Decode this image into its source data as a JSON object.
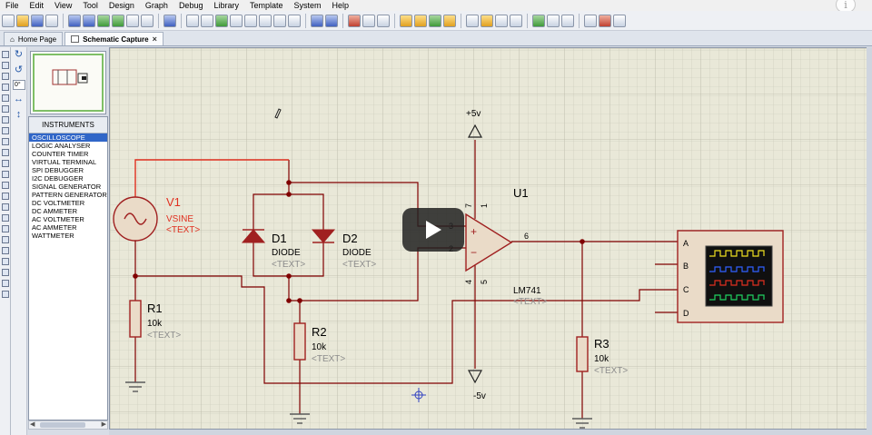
{
  "menu": [
    "File",
    "Edit",
    "View",
    "Tool",
    "Design",
    "Graph",
    "Debug",
    "Library",
    "Template",
    "System",
    "Help"
  ],
  "tabs": [
    {
      "label": "Home Page",
      "icon": "home-icon",
      "closable": false
    },
    {
      "label": "Schematic Capture",
      "icon": "schematic-icon",
      "closable": true
    }
  ],
  "left_panel": {
    "rotation_value": "0°",
    "devices_title": "INSTRUMENTS",
    "devices": [
      "OSCILLOSCOPE",
      "LOGIC ANALYSER",
      "COUNTER TIMER",
      "VIRTUAL TERMINAL",
      "SPI DEBUGGER",
      "I2C DEBUGGER",
      "SIGNAL GENERATOR",
      "PATTERN GENERATOR",
      "DC VOLTMETER",
      "DC AMMETER",
      "AC VOLTMETER",
      "AC AMMETER",
      "WATTMETER"
    ],
    "selected_index": 0
  },
  "schematic": {
    "v1": {
      "name": "V1",
      "type": "VSINE",
      "text": "<TEXT>"
    },
    "d1": {
      "name": "D1",
      "type": "DIODE",
      "text": "<TEXT>"
    },
    "d2": {
      "name": "D2",
      "type": "DIODE",
      "text": "<TEXT>"
    },
    "u1": {
      "name": "U1",
      "part": "LM741",
      "text": "<TEXT>",
      "pins": {
        "p3": "3",
        "p2": "2",
        "p6": "6",
        "p7": "7",
        "p4": "4",
        "p5": "5",
        "p1": "1"
      },
      "plus": "+",
      "minus": "−"
    },
    "r1": {
      "name": "R1",
      "value": "10k",
      "text": "<TEXT>"
    },
    "r2": {
      "name": "R2",
      "value": "10k",
      "text": "<TEXT>"
    },
    "r3": {
      "name": "R3",
      "value": "10k",
      "text": "<TEXT>"
    },
    "vcc": "+5v",
    "vee": "-5v",
    "scope_channels": [
      "A",
      "B",
      "C",
      "D"
    ],
    "wire_color": "#800000",
    "highlight_color": "#e03020",
    "component_color": "#a02020"
  },
  "overlay": {
    "info_icon": "i"
  }
}
